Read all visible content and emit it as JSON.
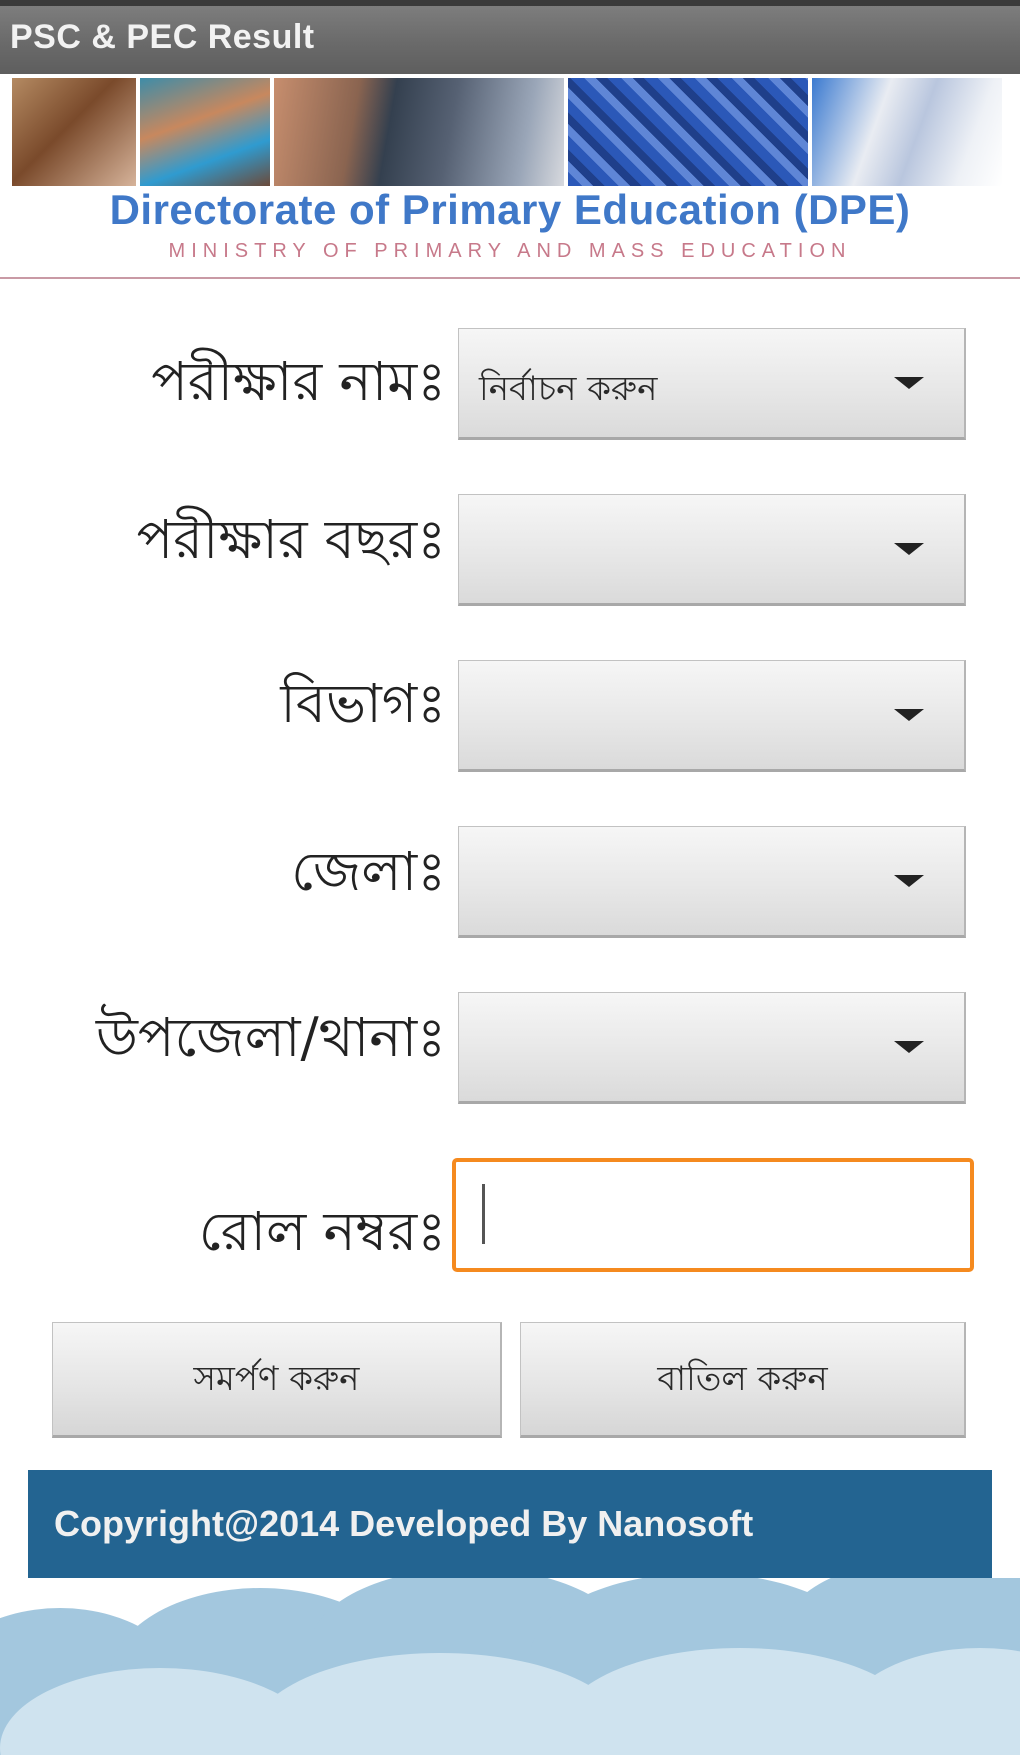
{
  "titlebar": {
    "title": "PSC & PEC Result"
  },
  "banner": {
    "title": "Directorate of Primary Education (DPE)",
    "subtitle": "Ministry of Primary and Mass Education"
  },
  "form": {
    "exam_name": {
      "label": "পরীক্ষার নামঃ",
      "value": "নির্বাচন করুন"
    },
    "exam_year": {
      "label": "পরীক্ষার বছরঃ",
      "value": ""
    },
    "division": {
      "label": "বিভাগঃ",
      "value": ""
    },
    "district": {
      "label": "জেলাঃ",
      "value": ""
    },
    "upazila": {
      "label": "উপজেলা/থানাঃ",
      "value": ""
    },
    "roll": {
      "label": "রোল নম্বরঃ",
      "value": ""
    },
    "submit_label": "সমর্পণ করুন",
    "cancel_label": "বাতিল করুন"
  },
  "footer": {
    "text": "Copyright@2014  Developed By Nanosoft"
  },
  "colors": {
    "titlebar": "#6a6a6a",
    "banner_title": "#3f78c8",
    "banner_subtitle": "#c7798a",
    "input_focus": "#f58a1f",
    "footer_bg": "#236491",
    "cloud_light": "#cfe3ef",
    "cloud_dark": "#a3c7de"
  }
}
